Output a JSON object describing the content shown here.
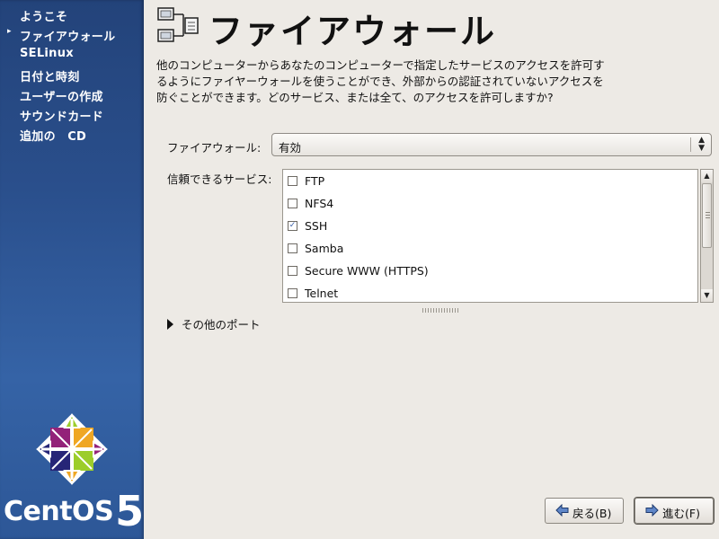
{
  "sidebar": {
    "items": [
      {
        "label": "ようこそ"
      },
      {
        "label": "ファイアウォール",
        "current": true
      },
      {
        "label": "SELinux"
      },
      {
        "label": "日付と時刻"
      },
      {
        "label": "ユーザーの作成"
      },
      {
        "label": "サウンドカード"
      },
      {
        "label": "追加の　CD"
      }
    ],
    "current_marker": "▸",
    "brand_word": "CentOS",
    "brand_number": "5"
  },
  "header": {
    "title": "ファイアウォール",
    "icon": "network-firewall-icon"
  },
  "intro_text": "他のコンピューターからあなたのコンピューターで指定したサービスのアクセスを許可するようにファイヤーウォールを使うことができ、外部からの認証されていないアクセスを防ぐことができます。どのサービス、または全て、のアクセスを許可しますか?",
  "firewall": {
    "label": "ファイアウォール:",
    "selected": "有効"
  },
  "services": {
    "label": "信頼できるサービス:",
    "items": [
      {
        "name": "FTP",
        "checked": false
      },
      {
        "name": "NFS4",
        "checked": false
      },
      {
        "name": "SSH",
        "checked": true
      },
      {
        "name": "Samba",
        "checked": false
      },
      {
        "name": "Secure WWW (HTTPS)",
        "checked": false
      },
      {
        "name": "Telnet",
        "checked": false
      }
    ]
  },
  "other_ports": {
    "label": "その他のポート",
    "expanded": false
  },
  "buttons": {
    "back_label": "戻る(B)",
    "next_label": "進む(F)"
  },
  "colors": {
    "sidebar_blue": "#2a4f8c",
    "background": "#edeae5",
    "check_blue": "#3a5fa8"
  }
}
